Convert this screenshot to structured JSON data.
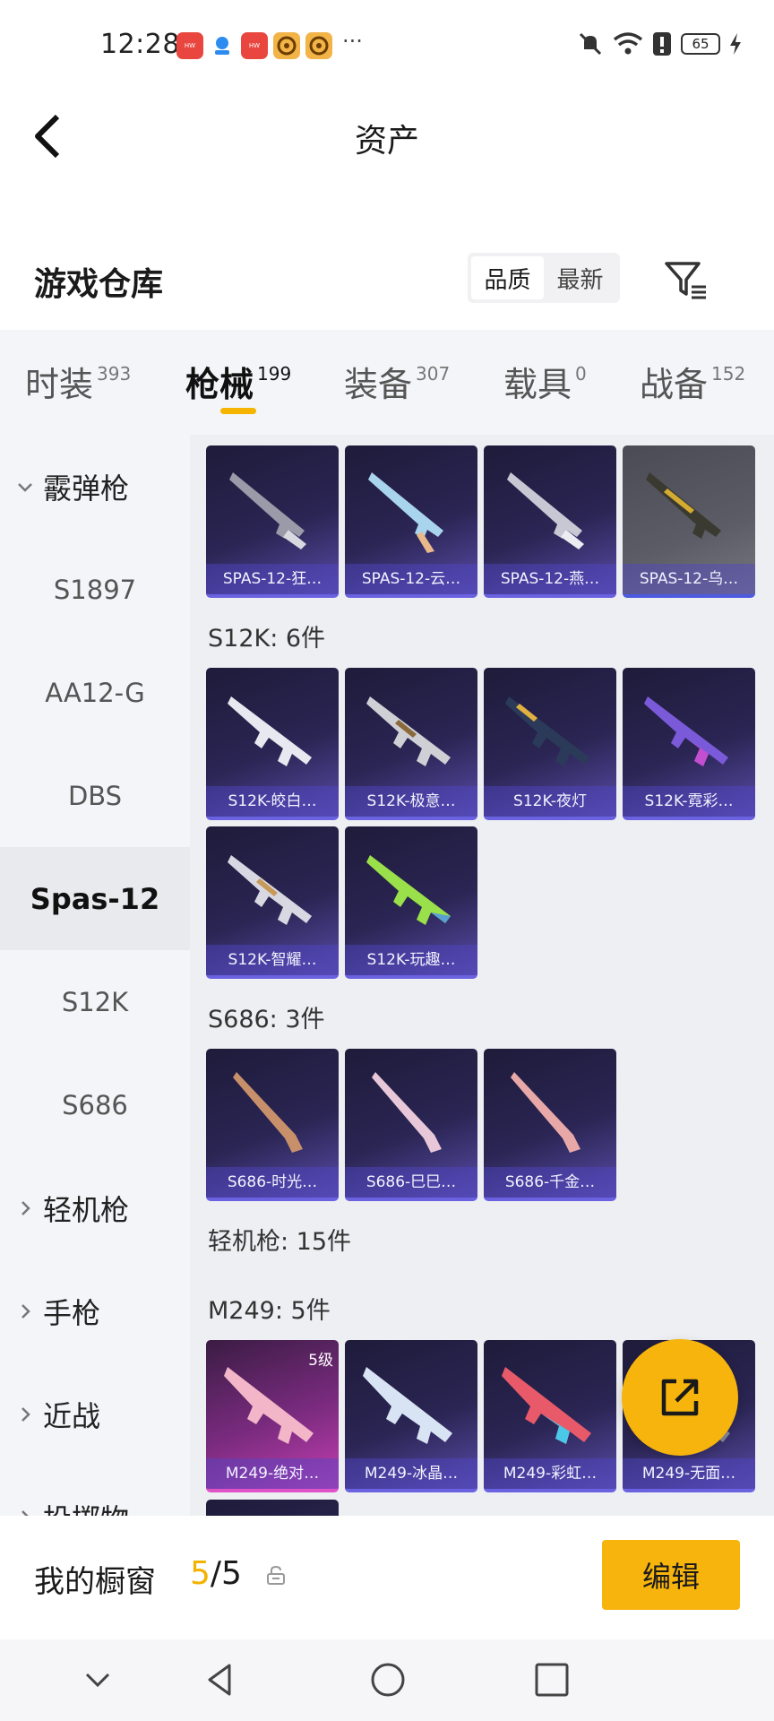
{
  "status_bar": {
    "time": "12:28",
    "overflow": "···",
    "battery": "65",
    "icons": [
      "huawei-app-icon",
      "cloud-app-icon",
      "huawei-app-icon",
      "game-app-icon",
      "game-app-icon",
      "mute-icon",
      "wifi-icon",
      "alert-icon",
      "battery-icon",
      "charging-icon"
    ]
  },
  "header": {
    "title": "资产"
  },
  "warehouse": {
    "title": "游戏仓库",
    "sort_options": [
      "品质",
      "最新"
    ],
    "sort_selected": "品质"
  },
  "tabs": [
    {
      "label": "时装",
      "count": "393"
    },
    {
      "label": "枪械",
      "count": "199",
      "active": true
    },
    {
      "label": "装备",
      "count": "307"
    },
    {
      "label": "载具",
      "count": "0"
    },
    {
      "label": "战备",
      "count": "152"
    }
  ],
  "sidebar": {
    "items": [
      {
        "label": "霰弹枪",
        "kind": "group",
        "expanded": true
      },
      {
        "label": "S1897",
        "kind": "sub"
      },
      {
        "label": "AA12-G",
        "kind": "sub"
      },
      {
        "label": "DBS",
        "kind": "sub"
      },
      {
        "label": "Spas-12",
        "kind": "sub",
        "selected": true
      },
      {
        "label": "S12K",
        "kind": "sub"
      },
      {
        "label": "S686",
        "kind": "sub"
      },
      {
        "label": "轻机枪",
        "kind": "group"
      },
      {
        "label": "手枪",
        "kind": "group"
      },
      {
        "label": "近战",
        "kind": "group"
      },
      {
        "label": "投掷物",
        "kind": "group"
      }
    ]
  },
  "content": {
    "spas_cards": [
      "SPAS-12-狂…",
      "SPAS-12-云…",
      "SPAS-12-燕…",
      "SPAS-12-乌…"
    ],
    "s12k_label": "S12K: 6件",
    "s12k_cards": [
      "S12K-皎白…",
      "S12K-极意…",
      "S12K-夜灯",
      "S12K-霓彩…",
      "S12K-智耀…",
      "S12K-玩趣…"
    ],
    "s686_label": "S686: 3件",
    "s686_cards": [
      "S686-时光…",
      "S686-巳巳…",
      "S686-千金…"
    ],
    "lmg_label": "轻机枪: 15件",
    "m249_label": "M249: 5件",
    "m249_cards": [
      "M249-绝对…",
      "M249-冰晶…",
      "M249-彩虹…",
      "M249-无面…"
    ],
    "m249_level_badge": "5级"
  },
  "showcase": {
    "label": "我的橱窗",
    "current": "5",
    "total": "/5",
    "edit_label": "编辑"
  },
  "colors": {
    "accent": "#f6b40d",
    "card_border": "#6a62e0",
    "card_bg_dark": "#1e1b3a"
  }
}
